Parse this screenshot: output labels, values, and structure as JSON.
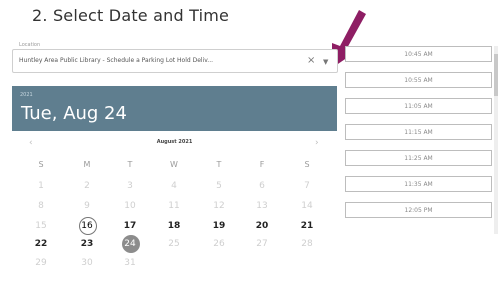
{
  "step": {
    "title": "2. Select Date and Time"
  },
  "location": {
    "label": "Location",
    "value": "Huntley Area Public Library - Schedule a Parking Lot Hold Deliv...",
    "clear_glyph": "×",
    "dropdown_glyph": "▼"
  },
  "date_header": {
    "year": "2021",
    "selected_date": "Tue, Aug 24"
  },
  "calendar": {
    "month_label": "August 2021",
    "prev_glyph": "‹",
    "next_glyph": "›",
    "days_of_week": [
      "S",
      "M",
      "T",
      "W",
      "T",
      "F",
      "S"
    ],
    "weeks": [
      [
        {
          "label": "1",
          "state": "disabled"
        },
        {
          "label": "2",
          "state": "disabled"
        },
        {
          "label": "3",
          "state": "disabled"
        },
        {
          "label": "4",
          "state": "disabled"
        },
        {
          "label": "5",
          "state": "disabled"
        },
        {
          "label": "6",
          "state": "disabled"
        },
        {
          "label": "7",
          "state": "disabled"
        }
      ],
      [
        {
          "label": "8",
          "state": "disabled"
        },
        {
          "label": "9",
          "state": "disabled"
        },
        {
          "label": "10",
          "state": "disabled"
        },
        {
          "label": "11",
          "state": "disabled"
        },
        {
          "label": "12",
          "state": "disabled"
        },
        {
          "label": "13",
          "state": "disabled"
        },
        {
          "label": "14",
          "state": "disabled"
        }
      ],
      [
        {
          "label": "15",
          "state": "disabled"
        },
        {
          "label": "16",
          "state": "today"
        },
        {
          "label": "17",
          "state": "available"
        },
        {
          "label": "18",
          "state": "available"
        },
        {
          "label": "19",
          "state": "available"
        },
        {
          "label": "20",
          "state": "available"
        },
        {
          "label": "21",
          "state": "available"
        }
      ],
      [
        {
          "label": "22",
          "state": "available"
        },
        {
          "label": "23",
          "state": "available"
        },
        {
          "label": "24",
          "state": "selected"
        },
        {
          "label": "25",
          "state": "disabled"
        },
        {
          "label": "26",
          "state": "disabled"
        },
        {
          "label": "27",
          "state": "disabled"
        },
        {
          "label": "28",
          "state": "disabled"
        }
      ],
      [
        {
          "label": "29",
          "state": "disabled"
        },
        {
          "label": "30",
          "state": "disabled"
        },
        {
          "label": "31",
          "state": "disabled"
        }
      ]
    ]
  },
  "time_slots": [
    "10:45 AM",
    "10:55 AM",
    "11:05 AM",
    "11:15 AM",
    "11:25 AM",
    "11:35 AM",
    "12:05 PM"
  ],
  "colors": {
    "header": "#5f7e8f",
    "arrow": "#8e1e64"
  },
  "icons": {
    "arrow": "arrow-down-left-icon",
    "clear": "close-icon",
    "dropdown": "chevron-down-icon"
  }
}
